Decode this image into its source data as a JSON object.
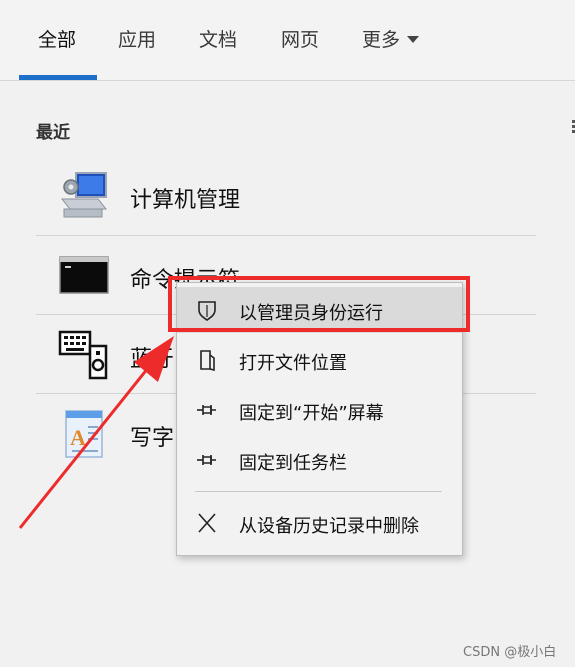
{
  "tabs": [
    {
      "label": "全部",
      "active": true
    },
    {
      "label": "应用",
      "active": false
    },
    {
      "label": "文档",
      "active": false
    },
    {
      "label": "网页",
      "active": false
    },
    {
      "label": "更多",
      "active": false
    }
  ],
  "recent_label": "最近",
  "apps": [
    {
      "name": "计算机管理",
      "icon": "computer-management-icon"
    },
    {
      "name": "命令提示符",
      "icon": "command-prompt-icon"
    },
    {
      "name": "蓝牙",
      "icon": "bluetooth-keyboard-icon"
    },
    {
      "name": "写字",
      "icon": "wordpad-icon"
    }
  ],
  "context_menu": {
    "items": [
      {
        "label": "以管理员身份运行",
        "icon": "shield-icon",
        "highlighted": true
      },
      {
        "label": "打开文件位置",
        "icon": "folder-location-icon"
      },
      {
        "label": "固定到“开始”屏幕",
        "icon": "pin-icon"
      },
      {
        "label": "固定到任务栏",
        "icon": "pin-icon"
      },
      {
        "label": "从设备历史记录中删除",
        "icon": "close-icon"
      }
    ]
  },
  "annotation_colors": {
    "highlight": "#ee2b2b",
    "arrow": "#ee2b2b",
    "accent": "#1b6fc9"
  },
  "watermark": "CSDN @极小白"
}
